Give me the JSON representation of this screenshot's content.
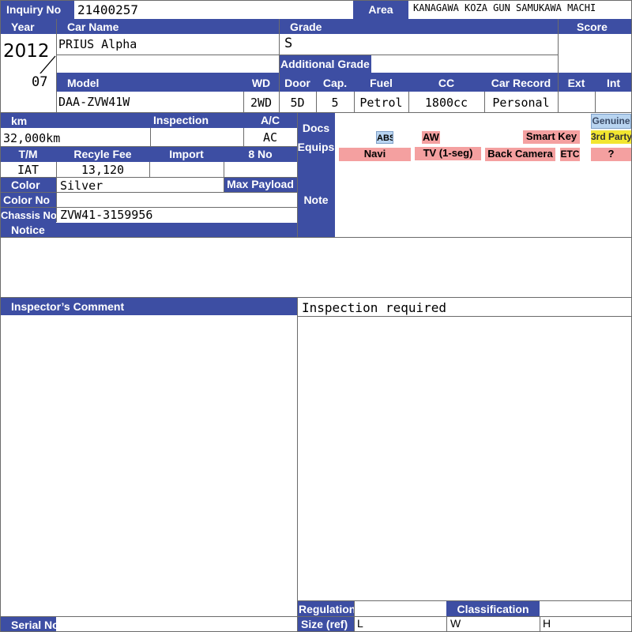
{
  "labels": {
    "inquiry_no": "Inquiry No",
    "area": "Area",
    "year": "Year",
    "car_name": "Car Name",
    "grade": "Grade",
    "score": "Score",
    "additional_grade": "Additional Grade",
    "model": "Model",
    "wd": "WD",
    "door": "Door",
    "cap": "Cap.",
    "fuel": "Fuel",
    "cc": "CC",
    "car_record": "Car Record",
    "ext": "Ext",
    "int": "Int",
    "km": "km",
    "inspection": "Inspection",
    "ac": "A/C",
    "docs": "Docs",
    "equips": "Equips",
    "tm": "T/M",
    "recycle_fee": "Recyle Fee",
    "import": "Import",
    "eight_no": "8 No",
    "color": "Color",
    "max_payload": "Max Payload",
    "color_no": "Color No",
    "note": "Note",
    "chassis_no": "Chassis No",
    "notice": "Notice",
    "inspectors_comment": "Inspector’s Comment",
    "regulation": "Regulation",
    "classification": "Classification",
    "size_ref": "Size (ref)",
    "serial_no": "Serial No"
  },
  "values": {
    "inquiry_no": "21400257",
    "area": "KANAGAWA KOZA GUN SAMUKAWA MACHI",
    "year": "2012",
    "month": "07",
    "car_name": "PRIUS Alpha",
    "grade": "S",
    "additional_grade": "",
    "score": "",
    "model": "DAA-ZVW41W",
    "wd": "2WD",
    "door": "5D",
    "cap": "5",
    "fuel": "Petrol",
    "cc": "1800cc",
    "car_record": "Personal",
    "ext": "",
    "int": "",
    "km": "32,000km",
    "inspection": "",
    "ac": "AC",
    "tm": "IAT",
    "recycle_fee": "13,120",
    "import": "",
    "eight_no": "",
    "color": "Silver",
    "max_payload": "",
    "color_no": "",
    "chassis_no": "ZVW41-3159956",
    "note": "",
    "notice": "",
    "comment_right": "Inspection required",
    "size_l": "L",
    "size_w": "W",
    "size_h": "H",
    "serial_no": ""
  },
  "equipment": {
    "abs": "ABS",
    "aw": "AW",
    "smart_key": "Smart Key",
    "navi": "Navi",
    "tv": "TV (1-seg)",
    "back_camera": "Back Camera",
    "etc": "ETC"
  },
  "legend": {
    "genuine": "Genuine",
    "third_party": "3rd Party",
    "unknown": "?"
  },
  "colors": {
    "header": "#3d4ea3",
    "genuine_chip": "#b8d4f0",
    "third_party_chip": "#f2e630",
    "unknown_chip": "#f4a0a0"
  }
}
